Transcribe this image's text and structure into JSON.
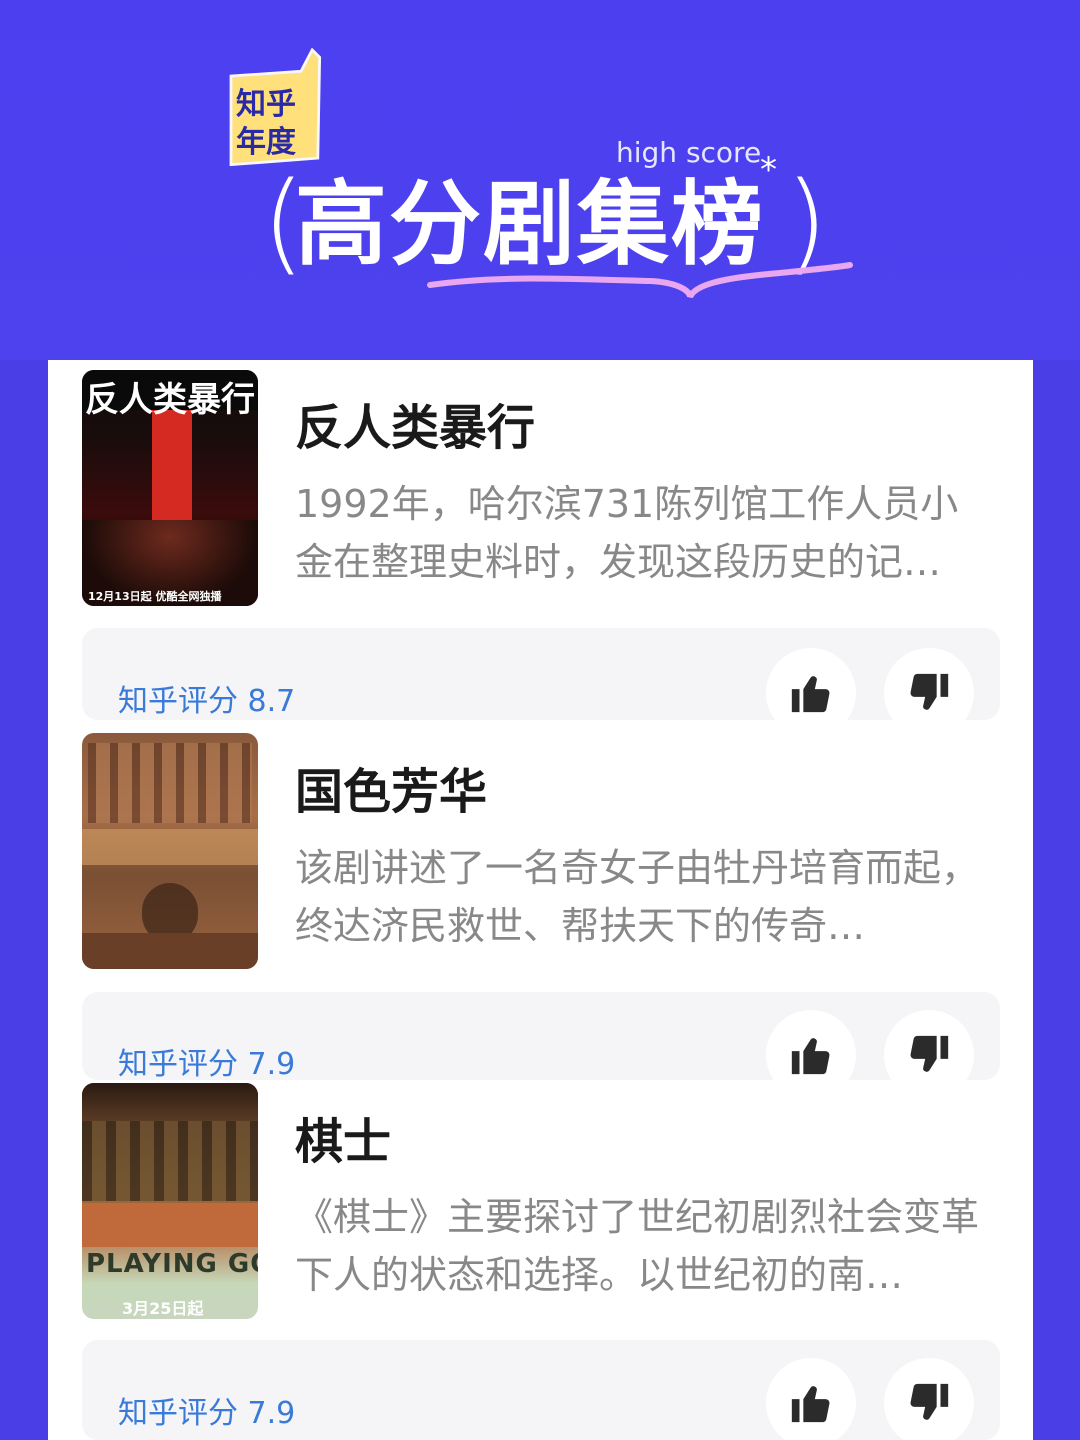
{
  "header": {
    "badge_line1": "知乎",
    "badge_line2": "年度",
    "high_score": "high score",
    "title": "高分剧集榜",
    "colors": {
      "background": "#4a3fe6",
      "badge": "#ffe07a",
      "underline": "#e9a7f0"
    }
  },
  "shows": [
    {
      "title": "反人类暴行",
      "description": "1992年，哈尔滨731陈列馆工作人员小金在整理史料时，发现这段历史的记…",
      "rating_label": "知乎评分 8.7",
      "poster_title": "反人类暴行",
      "poster_caption": "12月13日起 优酷全网独播"
    },
    {
      "title": "国色芳华",
      "description": "该剧讲述了一名奇女子由牡丹培育而起，终达济民救世、帮扶天下的传奇…",
      "rating_label": "知乎评分 7.9"
    },
    {
      "title": "棋士",
      "description": "《棋士》主要探讨了世纪初剧烈社会变革下人的状态和选择。以世纪初的南…",
      "rating_label": "知乎评分 7.9",
      "poster_title": "PLAYING GO",
      "poster_caption": "3月25日起"
    }
  ],
  "icons": {
    "like": "thumbs-up-icon",
    "dislike": "thumbs-down-icon"
  }
}
